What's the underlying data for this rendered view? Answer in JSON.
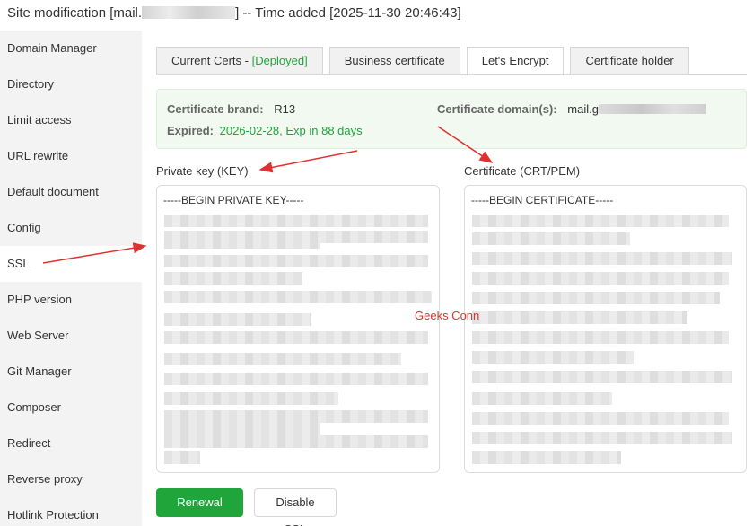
{
  "window": {
    "title_prefix": "Site modification [mail.",
    "title_suffix": "] -- Time added [2025-11-30 20:46:43]"
  },
  "sidebar": {
    "items": [
      {
        "label": "Domain Manager"
      },
      {
        "label": "Directory"
      },
      {
        "label": "Limit access"
      },
      {
        "label": "URL rewrite"
      },
      {
        "label": "Default document"
      },
      {
        "label": "Config"
      },
      {
        "label": "SSL"
      },
      {
        "label": "PHP version"
      },
      {
        "label": "Web Server"
      },
      {
        "label": "Git Manager"
      },
      {
        "label": "Composer"
      },
      {
        "label": "Redirect"
      },
      {
        "label": "Reverse proxy"
      },
      {
        "label": "Hotlink Protection"
      }
    ],
    "active": "SSL"
  },
  "tabs": {
    "current_certs": "Current Certs - ",
    "deployed": "[Deployed]",
    "business": "Business certificate",
    "letsencrypt": "Let's Encrypt",
    "holder": "Certificate holder"
  },
  "cert_info": {
    "brand_label": "Certificate brand:",
    "brand_value": "R13",
    "domains_label": "Certificate domain(s):",
    "domains_value_prefix": "mail.g",
    "expired_label": "Expired:",
    "expired_value": "2026-02-28, Exp in 88 days"
  },
  "key": {
    "label": "Private key (KEY)",
    "header": "-----BEGIN PRIVATE KEY-----"
  },
  "cert": {
    "label": "Certificate (CRT/PEM)",
    "header": "-----BEGIN CERTIFICATE-----"
  },
  "watermark": "Geeks Conn",
  "buttons": {
    "renewal": "Renewal SSL",
    "disable": "Disable SSL"
  },
  "colors": {
    "accent_green": "#20a53a",
    "annotation_red": "#e03030"
  }
}
